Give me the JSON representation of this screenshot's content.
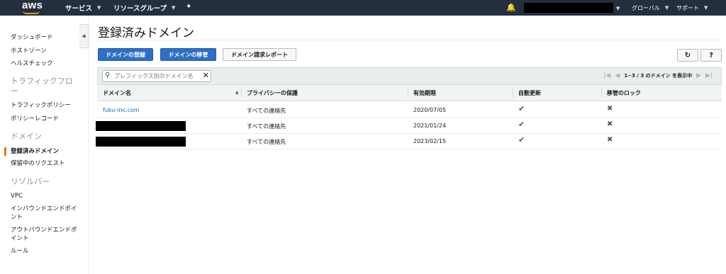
{
  "topnav": {
    "logo": "aws",
    "services": "サービス",
    "resource_groups": "リソースグループ",
    "region": "グローバル",
    "support": "サポート",
    "pin_icon": "pin-icon",
    "bell_icon": "bell-icon"
  },
  "sidebar": {
    "items": [
      {
        "label": "ダッシュボード"
      },
      {
        "label": "ホストゾーン"
      },
      {
        "label": "ヘルスチェック"
      }
    ],
    "section_traffic": "トラフィックフロー",
    "traffic_items": [
      {
        "label": "トラフィックポリシー"
      },
      {
        "label": "ポリシーレコード"
      }
    ],
    "section_domains": "ドメイン",
    "domain_items": [
      {
        "label": "登録済みドメイン"
      },
      {
        "label": "保留中のリクエスト"
      }
    ],
    "section_resolver": "リゾルバー",
    "resolver_items": [
      {
        "label": "VPC"
      },
      {
        "label": "インバウンドエンドポイント"
      },
      {
        "label": "アウトバウンドエンドポイント"
      },
      {
        "label": "ルール"
      }
    ]
  },
  "main": {
    "title": "登録済みドメイン",
    "buttons": {
      "register": "ドメインの登録",
      "transfer": "ドメインの移管",
      "billing_report": "ドメイン請求レポート"
    },
    "search": {
      "placeholder": "プレフィックス別のドメイン名"
    },
    "pager": {
      "text": "1~3 / 3 のドメイン を表示中"
    },
    "columns": [
      "ドメイン名",
      "プライバシーの保護",
      "有効期限",
      "自動更新",
      "移管のロック"
    ],
    "rows": [
      {
        "domain": "fuku-inc.com",
        "privacy": "すべての連絡先",
        "expiry": "2020/07/05"
      },
      {
        "domain": "",
        "privacy": "すべての連絡先",
        "expiry": "2021/01/24"
      },
      {
        "domain": "",
        "privacy": "すべての連絡先",
        "expiry": "2023/02/15"
      }
    ]
  },
  "colors": {
    "nav_bg": "#232f3e",
    "primary": "#2d6fc7",
    "accent": "#ec7211",
    "link": "#0073bb"
  }
}
